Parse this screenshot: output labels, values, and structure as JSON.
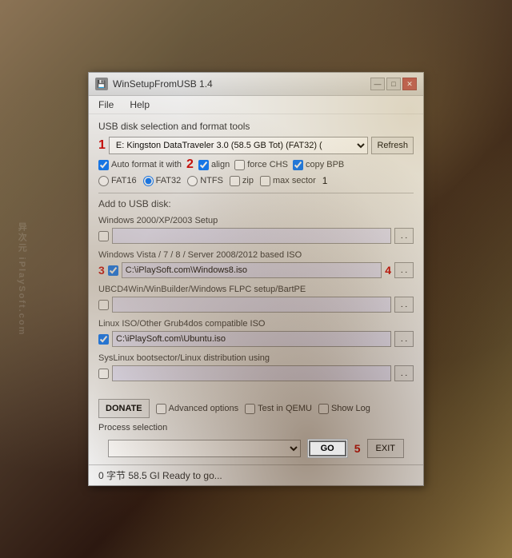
{
  "watermark": {
    "line1": "异次元",
    "line2": "iPlaySoft.com"
  },
  "window": {
    "title": "WinSetupFromUSB 1.4",
    "icon": "💾"
  },
  "titlebar": {
    "controls": {
      "minimize": "—",
      "maximize": "□",
      "close": "✕"
    }
  },
  "menu": {
    "items": [
      "File",
      "Help"
    ]
  },
  "disk_section": {
    "label": "USB disk selection and format tools",
    "disk_value": "E: Kingston DataTraveler 3.0 (58.5 GB Tot) (FAT32) (",
    "refresh_label": "Refresh",
    "badge1": "1",
    "badge2": "2"
  },
  "format": {
    "auto_format_label": "Auto format it with",
    "checkboxes": {
      "align": {
        "label": "align",
        "checked": true
      },
      "force_chs": {
        "label": "force CHS",
        "checked": false
      },
      "copy_bpb": {
        "label": "copy BPB",
        "checked": true
      },
      "zip": {
        "label": "zip",
        "checked": false
      },
      "max_sector": {
        "label": "max sector",
        "checked": false
      },
      "max_sector_val": "1"
    },
    "radios": {
      "fat16": {
        "label": "FAT16",
        "checked": false
      },
      "fat32": {
        "label": "FAT32",
        "checked": true
      },
      "ntfs": {
        "label": "NTFS",
        "checked": false
      }
    }
  },
  "add_section": {
    "label": "Add to USB disk:",
    "items": [
      {
        "title": "Windows 2000/XP/2003 Setup",
        "checked": false,
        "path": "",
        "has_path": false,
        "badge": null
      },
      {
        "title": "Windows Vista / 7 / 8 / Server 2008/2012 based ISO",
        "checked": true,
        "path": "C:\\iPlaySoft.com\\Windows8.iso",
        "has_path": true,
        "badge3": "3",
        "badge4": "4"
      },
      {
        "title": "UBCD4Win/WinBuilder/Windows FLPC setup/BartPE",
        "checked": false,
        "path": "",
        "has_path": false,
        "badge": null
      },
      {
        "title": "Linux ISO/Other Grub4dos compatible ISO",
        "checked": true,
        "path": "C:\\iPlaySoft.com\\Ubuntu.iso",
        "has_path": true,
        "badge": null
      },
      {
        "title": "SysLinux bootsector/Linux distribution using",
        "checked": false,
        "path": "",
        "has_path": false,
        "badge": null
      }
    ]
  },
  "bottom": {
    "donate_label": "DONATE",
    "advanced_label": "Advanced options",
    "test_qemu_label": "Test in QEMU",
    "show_log_label": "Show Log"
  },
  "process": {
    "label": "Process selection",
    "go_label": "GO",
    "badge5": "5",
    "exit_label": "EXIT"
  },
  "status": {
    "text": "0 字节  58.5 GI Ready to go..."
  }
}
